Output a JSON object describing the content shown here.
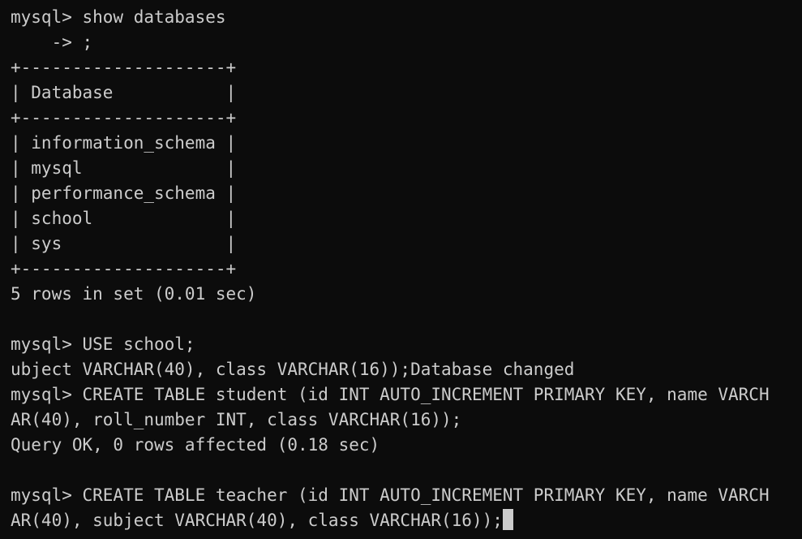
{
  "terminal": {
    "lines": [
      "mysql> show databases",
      "    -> ;",
      "+--------------------+",
      "| Database           |",
      "+--------------------+",
      "| information_schema |",
      "| mysql              |",
      "| performance_schema |",
      "| school             |",
      "| sys                |",
      "+--------------------+",
      "5 rows in set (0.01 sec)",
      "",
      "mysql> USE school;",
      "ubject VARCHAR(40), class VARCHAR(16));Database changed",
      "mysql> CREATE TABLE student (id INT AUTO_INCREMENT PRIMARY KEY, name VARCH",
      "AR(40), roll_number INT, class VARCHAR(16));",
      "Query OK, 0 rows affected (0.18 sec)",
      "",
      "mysql> CREATE TABLE teacher (id INT AUTO_INCREMENT PRIMARY KEY, name VARCH",
      "AR(40), subject VARCHAR(40), class VARCHAR(16));"
    ],
    "colors": {
      "background": "#0c0c0c",
      "foreground": "#cccccc",
      "cursor": "#cccccc"
    }
  }
}
